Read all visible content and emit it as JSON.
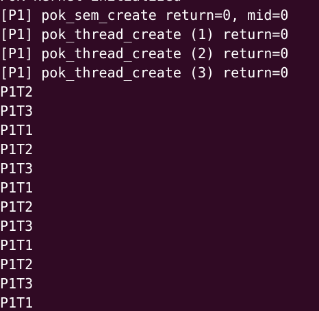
{
  "terminal": {
    "lines": [
      "POK kernel initialized",
      "[P1] pok_sem_create return=0, mid=0",
      "[P1] pok_thread_create (1) return=0",
      "[P1] pok_thread_create (2) return=0",
      "[P1] pok_thread_create (3) return=0",
      "P1T2",
      "P1T3",
      "P1T1",
      "P1T2",
      "P1T3",
      "P1T1",
      "P1T2",
      "P1T3",
      "P1T1",
      "P1T2",
      "P1T3",
      "P1T1"
    ]
  },
  "colors": {
    "background": "#300a24",
    "text": "#ffffff"
  }
}
